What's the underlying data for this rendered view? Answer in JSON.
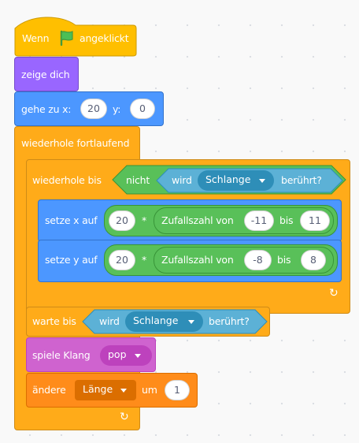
{
  "script": {
    "hat": {
      "label_before": "Wenn",
      "label_after": "angeklickt",
      "icon": "green-flag-icon"
    },
    "show": {
      "label": "zeige dich"
    },
    "goto": {
      "label": "gehe zu x:",
      "x_value": "20",
      "y_label": "y:",
      "y_value": "0"
    },
    "forever": {
      "label": "wiederhole fortlaufend"
    },
    "repeat_until": {
      "label": "wiederhole bis",
      "not_label": "nicht",
      "touching_label": "wird",
      "touching_target": "Schlange",
      "touching_suffix": "berührt?"
    },
    "set_x": {
      "label": "setze x auf",
      "left": "20",
      "op": "*",
      "random_label": "Zufallszahl von",
      "from": "-11",
      "to_label": "bis",
      "to": "11"
    },
    "set_y": {
      "label": "setze y auf",
      "left": "20",
      "op": "*",
      "random_label": "Zufallszahl von",
      "from": "-8",
      "to_label": "bis",
      "to": "8"
    },
    "wait_until": {
      "label": "warte bis",
      "touching_label": "wird",
      "touching_target": "Schlange",
      "touching_suffix": "berührt?"
    },
    "play_sound": {
      "label": "spiele Klang",
      "sound": "pop"
    },
    "change_var": {
      "label": "ändere",
      "variable": "Länge",
      "by_label": "um",
      "value": "1"
    }
  },
  "colors": {
    "events": "#ffbf00",
    "looks": "#9966ff",
    "motion": "#4c97ff",
    "control": "#ffab19",
    "operators": "#59c059",
    "sensing": "#5cb1d6",
    "sound": "#cf63cf",
    "variables": "#ff8c1a"
  }
}
